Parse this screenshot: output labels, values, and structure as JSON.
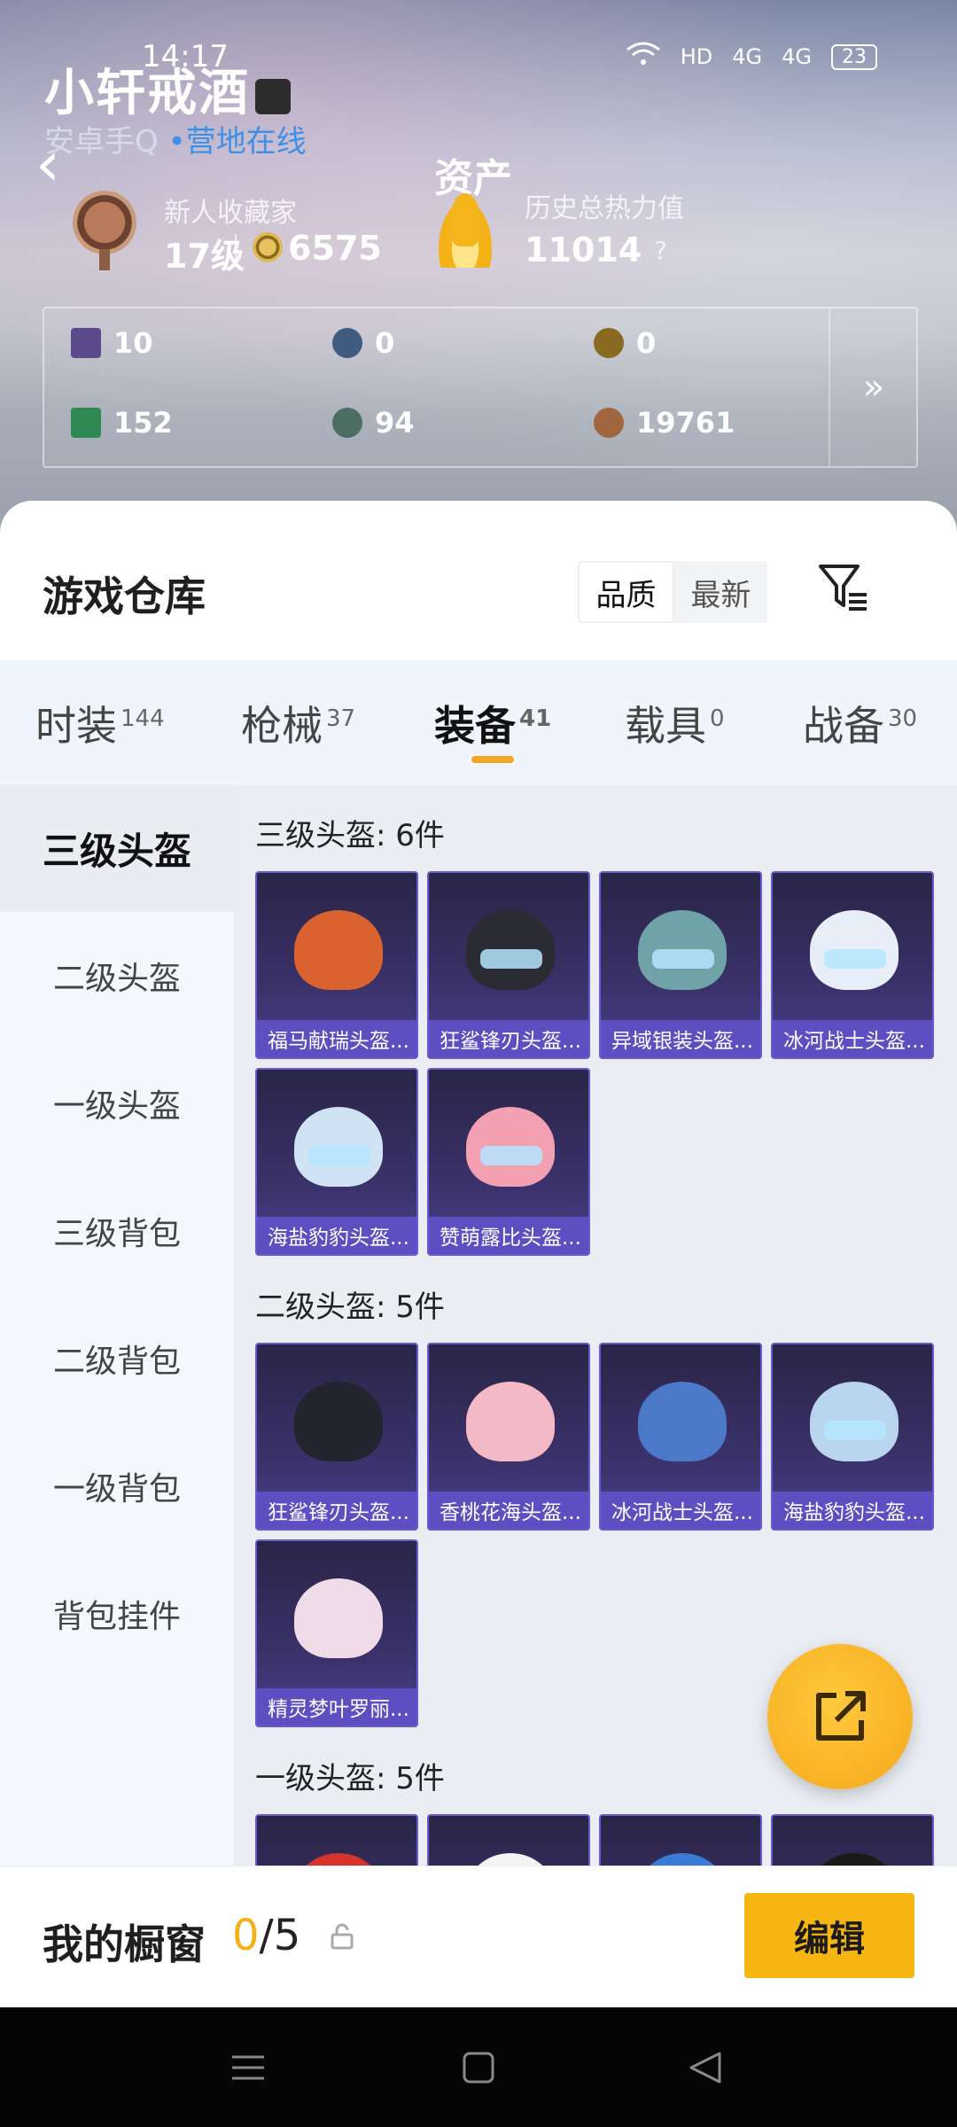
{
  "status_bar": {
    "time": "14:17",
    "network_hd": "HD",
    "network_4g_1": "4G",
    "network_4g_2": "4G",
    "battery": "23"
  },
  "profile": {
    "name": "小轩戒酒",
    "platform": "安卓手Q",
    "online_status": "营地在线",
    "page_title": "资产",
    "collector_title": "新人收藏家",
    "level": "17级",
    "coins": "6575",
    "heat_label": "历史总热力值",
    "heat_value": "11014",
    "help_icon": "?"
  },
  "stats": [
    {
      "icon": "card-icon",
      "value": "10",
      "color": "#5a4a8a"
    },
    {
      "icon": "badge-s-icon",
      "value": "0",
      "color": "#3f5d80"
    },
    {
      "icon": "badge-a-icon",
      "value": "0",
      "color": "#8a6a20"
    },
    {
      "icon": "green-card-icon",
      "value": "152",
      "color": "#2e8a52"
    },
    {
      "icon": "green-coin-icon",
      "value": "94",
      "color": "#4b6d62"
    },
    {
      "icon": "bronze-coin-icon",
      "value": "19761",
      "color": "#a0663e"
    }
  ],
  "stats_more": "»",
  "warehouse": {
    "title": "游戏仓库",
    "sort_quality": "品质",
    "sort_latest": "最新"
  },
  "tabs": [
    {
      "label": "时装",
      "count": "144"
    },
    {
      "label": "枪械",
      "count": "37"
    },
    {
      "label": "装备",
      "count": "41"
    },
    {
      "label": "载具",
      "count": "0"
    },
    {
      "label": "战备",
      "count": "30"
    }
  ],
  "side_menu": [
    "三级头盔",
    "二级头盔",
    "一级头盔",
    "三级背包",
    "二级背包",
    "一级背包",
    "背包挂件"
  ],
  "sections": [
    {
      "title": "三级头盔: 6件",
      "items": [
        {
          "name": "福马献瑞头盔...",
          "color": "#d9622e"
        },
        {
          "name": "狂鲨锋刃头盔...",
          "color": "#2b2b33"
        },
        {
          "name": "异域银装头盔...",
          "color": "#6fa3a8"
        },
        {
          "name": "冰河战士头盔...",
          "color": "#e8eef7"
        },
        {
          "name": "海盐豹豹头盔...",
          "color": "#cfe3f4"
        },
        {
          "name": "赞萌露比头盔...",
          "color": "#f2a0b2"
        }
      ]
    },
    {
      "title": "二级头盔: 5件",
      "items": [
        {
          "name": "狂鲨锋刃头盔...",
          "color": "#22242e"
        },
        {
          "name": "香桃花海头盔...",
          "color": "#f4b9c6"
        },
        {
          "name": "冰河战士头盔...",
          "color": "#4b78c8"
        },
        {
          "name": "海盐豹豹头盔...",
          "color": "#b9d6ee"
        },
        {
          "name": "精灵梦叶罗丽...",
          "color": "#f0dbe8"
        }
      ]
    },
    {
      "title": "一级头盔: 5件",
      "items": [
        {
          "name": "",
          "color": "#d8332b"
        },
        {
          "name": "",
          "color": "#f4f4f4"
        },
        {
          "name": "",
          "color": "#3a7bd5"
        },
        {
          "name": "",
          "color": "#1a1a1a"
        }
      ]
    }
  ],
  "showcase": {
    "label": "我的橱窗",
    "current": "0",
    "total": "/5",
    "edit_label": "编辑"
  }
}
